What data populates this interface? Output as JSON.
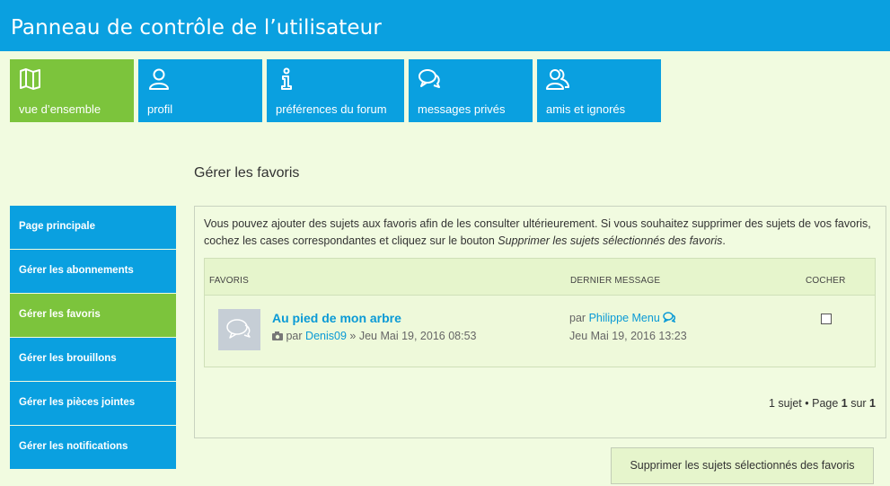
{
  "header": {
    "title": "Panneau de contrôle de l’utilisateur"
  },
  "tabs": [
    {
      "label": "vue d’ensemble",
      "icon": "map-icon",
      "active": true
    },
    {
      "label": "profil",
      "icon": "user-icon",
      "active": false
    },
    {
      "label": "préférences du forum",
      "icon": "info-icon",
      "active": false
    },
    {
      "label": "messages privés",
      "icon": "chat-icon",
      "active": false
    },
    {
      "label": "amis et ignorés",
      "icon": "friends-icon",
      "active": false
    }
  ],
  "section_title": "Gérer les favoris",
  "sidebar": {
    "items": [
      {
        "label": "Page principale",
        "active": false
      },
      {
        "label": "Gérer les abonnements",
        "active": false
      },
      {
        "label": "Gérer les favoris",
        "active": true
      },
      {
        "label": "Gérer les brouillons",
        "active": false
      },
      {
        "label": "Gérer les pièces jointes",
        "active": false
      },
      {
        "label": "Gérer les notifications",
        "active": false
      }
    ]
  },
  "intro": {
    "text": "Vous pouvez ajouter des sujets aux favoris afin de les consulter ultérieurement. Si vous souhaitez supprimer des sujets de vos favoris, cochez les cases correspondantes et cliquez sur le bouton ",
    "emphasis": "Supprimer les sujets sélectionnés des favoris",
    "end": "."
  },
  "table": {
    "col_favoris": "FAVORIS",
    "col_last": "DERNIER MESSAGE",
    "col_check": "COCHER",
    "topic": {
      "title": "Au pied de mon arbre",
      "by_prefix": "par",
      "author": "Denis09",
      "date": "» Jeu Mai 19, 2016 08:53",
      "last_prefix": "par",
      "last_author": "Philippe Menu",
      "last_date": "Jeu Mai 19, 2016 13:23",
      "checked": false
    }
  },
  "pagination": {
    "count": "1 sujet",
    "separator": " • Page ",
    "page": "1",
    "of": " sur ",
    "total": "1"
  },
  "button": {
    "delete_label": "Supprimer les sujets sélectionnés des favoris"
  },
  "colors": {
    "blue": "#0aa0e0",
    "green": "#7cc43c",
    "background": "#f1fbe0",
    "link": "#0a9ad6"
  }
}
